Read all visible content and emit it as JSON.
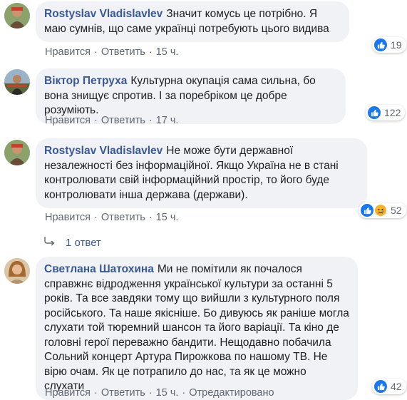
{
  "comments": [
    {
      "author": "Rostyslav Vladislavlev",
      "text": "Значит комусь це потрібно. Я маю сумнів, що саме українці потребують цього видива",
      "like": "Нравится",
      "reply": "Ответить",
      "time": "15 ч.",
      "reactions": "19"
    },
    {
      "author": "Віктор Петруха",
      "text": "Культурна окупація сама сильна, бо вона знищує спротив. І за поребріком це добре розуміють.",
      "like": "Нравится",
      "reply": "Ответить",
      "time": "17 ч.",
      "reactions": "122"
    },
    {
      "author": "Rostyslav Vladislavlev",
      "text": "Не може бути державної незалежності без інформаційної. Якщо Україна не в стані контролювати свій інформаційний простір, то його буде контролювати інша держава (держави).",
      "like": "Нравится",
      "reply": "Ответить",
      "time": "15 ч.",
      "reactions": "52"
    },
    {
      "author": "Светлана Шатохина",
      "text": "Ми не помітили як почалося справжнє відродження української культури за останні 5 років. Та все завдяки тому що вийшли з культурного поля російського. Та наше якісніше. Бо дивуюсь як раніше могла слухати той тюремний шансон та його варіації. Та кіно де головні герої переважно бандити. Нещодавно побачила Сольний концерт Артура Пирожкова по нашому ТВ. Не вірю очам. Як це потрапило до нас, та як це можно слухати",
      "like": "Нравится",
      "reply": "Ответить",
      "time": "15 ч.",
      "edited": "Отредактировано",
      "reactions": "42"
    }
  ],
  "replies_link": "1 ответ",
  "icons": [
    "like-icon",
    "sad-icon",
    "reply-arrow-icon"
  ],
  "colors": {
    "author": "#385898",
    "bubble": "#f0f2f5",
    "like": "#1877f2",
    "meta": "#606770"
  }
}
